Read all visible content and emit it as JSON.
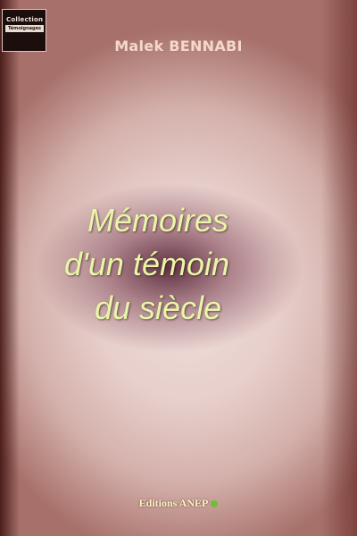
{
  "collection_badge": {
    "line1": "Collection",
    "line2": "Témoignages"
  },
  "author": "Malek BENNABI",
  "title_lines": [
    "Mémoires",
    "d'un témoin",
    "du siècle"
  ],
  "publisher": "Editions ANEP",
  "colors": {
    "title": "#e9f6a8",
    "author": "#f4d8c8",
    "publisher": "#fbf4c4",
    "publisher_logo": "#6dbf3a",
    "top_band": "#6a1c16"
  }
}
